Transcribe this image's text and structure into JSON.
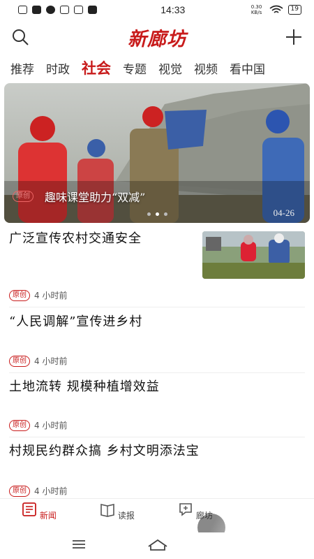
{
  "status": {
    "time": "14:33",
    "battery": "19",
    "net_speed": "0.30 KB/s"
  },
  "app": {
    "logo": "新廊坊"
  },
  "tabs": [
    "推荐",
    "时政",
    "社会",
    "专题",
    "视觉",
    "视频",
    "看中国"
  ],
  "active_tab": "社会",
  "hero": {
    "badge": "原创",
    "caption": "趣味课堂助力“双减”",
    "date": "04-26"
  },
  "articles": [
    {
      "title": "广泛宣传农村交通安全",
      "tag": "原创",
      "time": "4  小时前"
    },
    {
      "title": "“人民调解”宣传进乡村",
      "tag": "原创",
      "time": "4  小时前"
    },
    {
      "title": "土地流转  规模种植增效益",
      "tag": "原创",
      "time": "4  小时前"
    },
    {
      "title": "村规民约群众搞  乡村文明添法宝",
      "tag": "原创",
      "time": "4  小时前"
    }
  ],
  "bottom_nav": [
    {
      "label": "新闻",
      "icon": "news-icon"
    },
    {
      "label": "读报",
      "icon": "book-icon"
    },
    {
      "label": "廊坊",
      "icon": "langfang-icon"
    }
  ],
  "colors": {
    "brand": "#c81b1b"
  }
}
